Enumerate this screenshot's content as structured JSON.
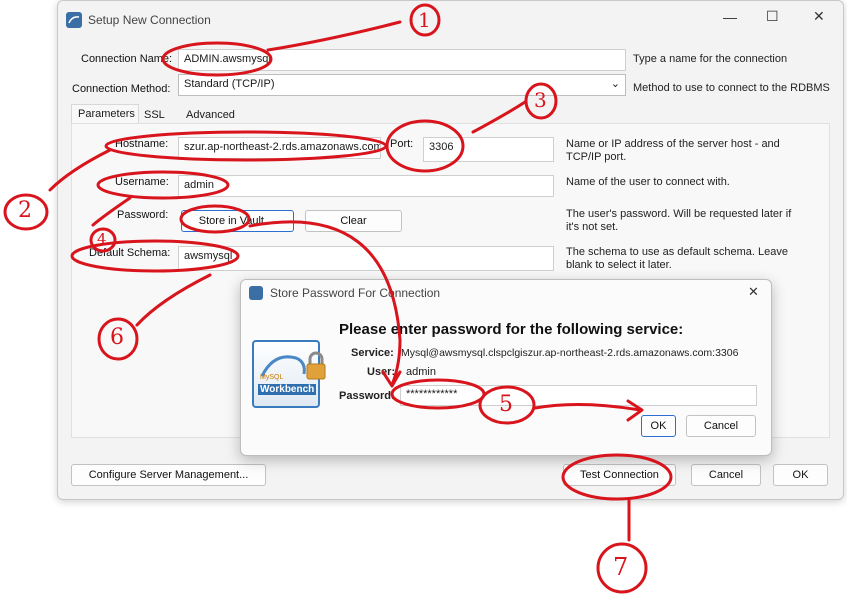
{
  "window": {
    "title": "Setup New Connection",
    "controls": {
      "minimize": "—",
      "maximize": "☐",
      "close": "✕"
    }
  },
  "form": {
    "connection_name": {
      "label": "Connection Name:",
      "value": "ADMIN.awsmysql",
      "desc": "Type a name for the connection"
    },
    "connection_method": {
      "label": "Connection Method:",
      "value": "Standard (TCP/IP)",
      "desc": "Method to use to connect to the RDBMS"
    }
  },
  "tabs": [
    "Parameters",
    "SSL",
    "Advanced"
  ],
  "params": {
    "hostname": {
      "label": "Hostname:",
      "value": "szur.ap-northeast-2.rds.amazonaws.com",
      "desc": "Name or IP address of the server host - and TCP/IP port."
    },
    "port": {
      "label": "Port:",
      "value": "3306"
    },
    "username": {
      "label": "Username:",
      "value": "admin",
      "desc": "Name of the user to connect with."
    },
    "password": {
      "label": "Password:",
      "store_button": "Store in Vault ...",
      "clear_button": "Clear",
      "desc": "The user's password. Will be requested later if it's not set."
    },
    "default_schema": {
      "label": "Default Schema:",
      "value": "awsmysql",
      "desc": "The schema to use as default schema. Leave blank to select it later."
    }
  },
  "bottom": {
    "configure_button": "Configure Server Management...",
    "test_button": "Test Connection",
    "cancel_button": "Cancel",
    "ok_button": "OK"
  },
  "dialog": {
    "title": "Store Password For Connection",
    "close": "✕",
    "heading": "Please enter password for the following service:",
    "service_label": "Service:",
    "service_value": "Mysql@awsmysql.clspclgiszur.ap-northeast-2.rds.amazonaws.com:3306",
    "user_label": "User:",
    "user_value": "admin",
    "password_label": "Password:",
    "password_value": "************",
    "ok_button": "OK",
    "cancel_button": "Cancel",
    "logo_text": "Workbench",
    "logo_sub": "MySQL"
  },
  "annotations": [
    "1",
    "2",
    "3",
    "4",
    "5",
    "6",
    "7"
  ],
  "colors": {
    "annotation": "#d8141c",
    "focus": "#2b6fd1"
  }
}
